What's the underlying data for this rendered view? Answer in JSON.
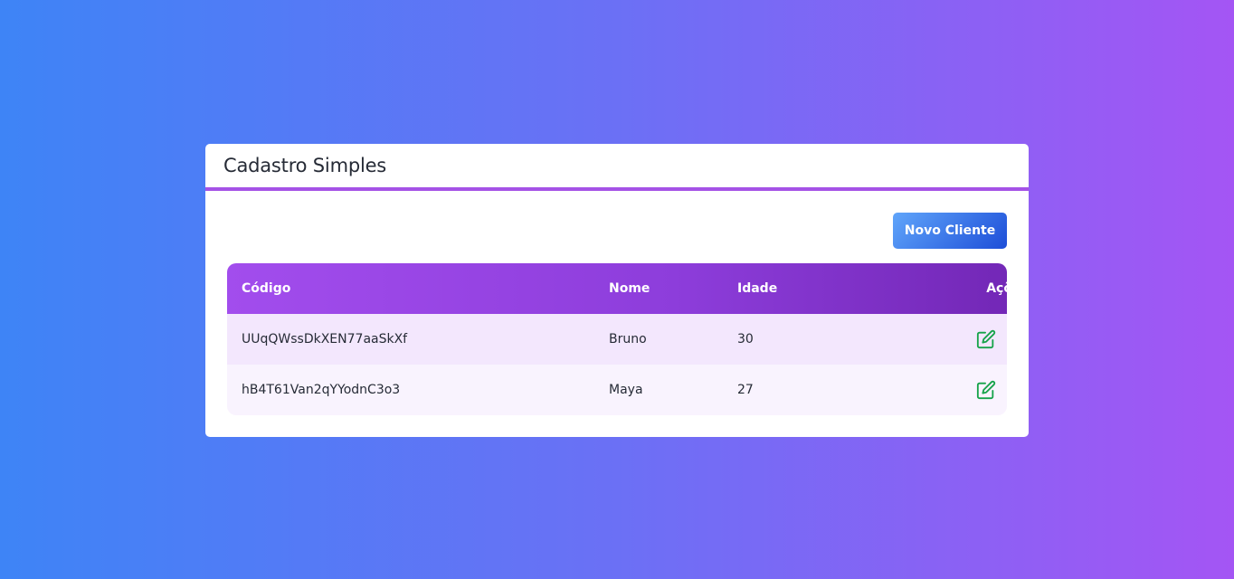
{
  "card": {
    "title": "Cadastro Simples",
    "new_button_label": "Novo Cliente"
  },
  "table": {
    "headers": {
      "code": "Código",
      "name": "Nome",
      "age": "Idade",
      "actions": "Ações"
    },
    "rows": [
      {
        "code": "UUqQWssDkXEN77aaSkXf",
        "name": "Bruno",
        "age": "30"
      },
      {
        "code": "hB4T61Van2qYYodnC3o3",
        "name": "Maya",
        "age": "27"
      }
    ]
  },
  "icons": {
    "edit": "edit-icon",
    "delete": "trash-icon"
  },
  "colors": {
    "edit": "#16a34a",
    "delete": "#ef4444",
    "accent": "#a552e6"
  }
}
